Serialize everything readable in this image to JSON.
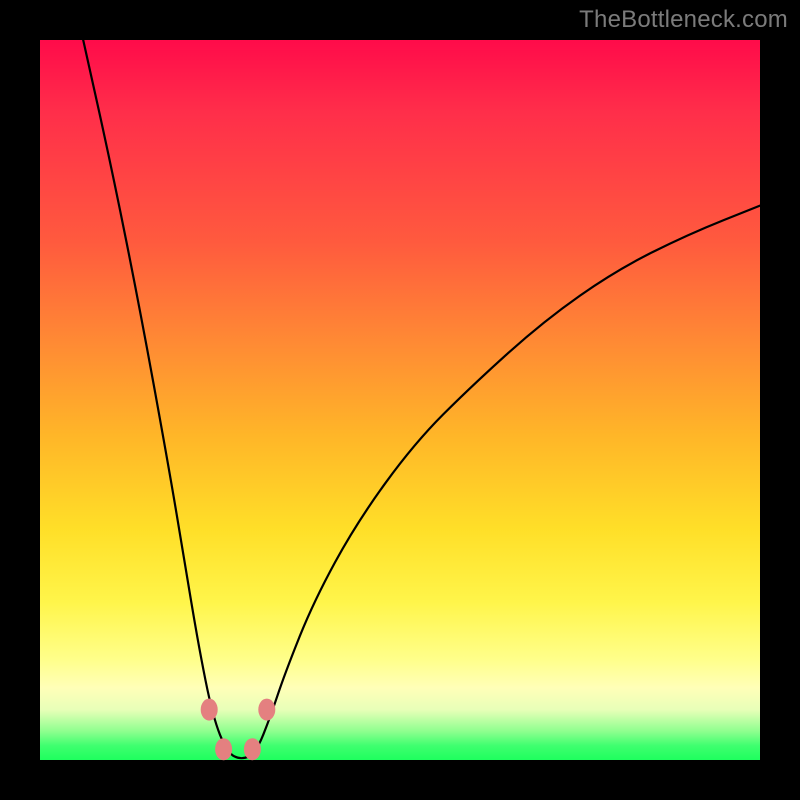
{
  "watermark": "TheBottleneck.com",
  "colors": {
    "frame": "#000000",
    "gradient_top": "#ff0b4a",
    "gradient_bottom": "#1eff5e",
    "curve": "#000000",
    "beads": "#e48080",
    "watermark_text": "#7b7b7b"
  },
  "chart_data": {
    "type": "line",
    "title": "",
    "xlabel": "",
    "ylabel": "",
    "xlim": [
      0,
      100
    ],
    "ylim": [
      0,
      100
    ],
    "notes": "V-shaped bottleneck curve over a red→green vertical gradient. Left branch descends steeply from top-left to a flat trough near x≈24–31 at y≈0; right branch rises with decreasing slope toward top-right, ending near y≈77 at x=100. Four pink beads mark the trough edges.",
    "series": [
      {
        "name": "bottleneck-curve",
        "x": [
          6,
          10,
          14,
          18,
          20,
          22,
          24,
          26,
          28,
          30,
          32,
          34,
          38,
          44,
          52,
          60,
          70,
          80,
          90,
          100
        ],
        "y": [
          100,
          82,
          62,
          40,
          28,
          16,
          6,
          1,
          0,
          1,
          6,
          12,
          22,
          33,
          44,
          52,
          61,
          68,
          73,
          77
        ]
      }
    ],
    "markers": [
      {
        "x": 23.5,
        "y": 7
      },
      {
        "x": 25.5,
        "y": 1.5
      },
      {
        "x": 29.5,
        "y": 1.5
      },
      {
        "x": 31.5,
        "y": 7
      }
    ]
  }
}
